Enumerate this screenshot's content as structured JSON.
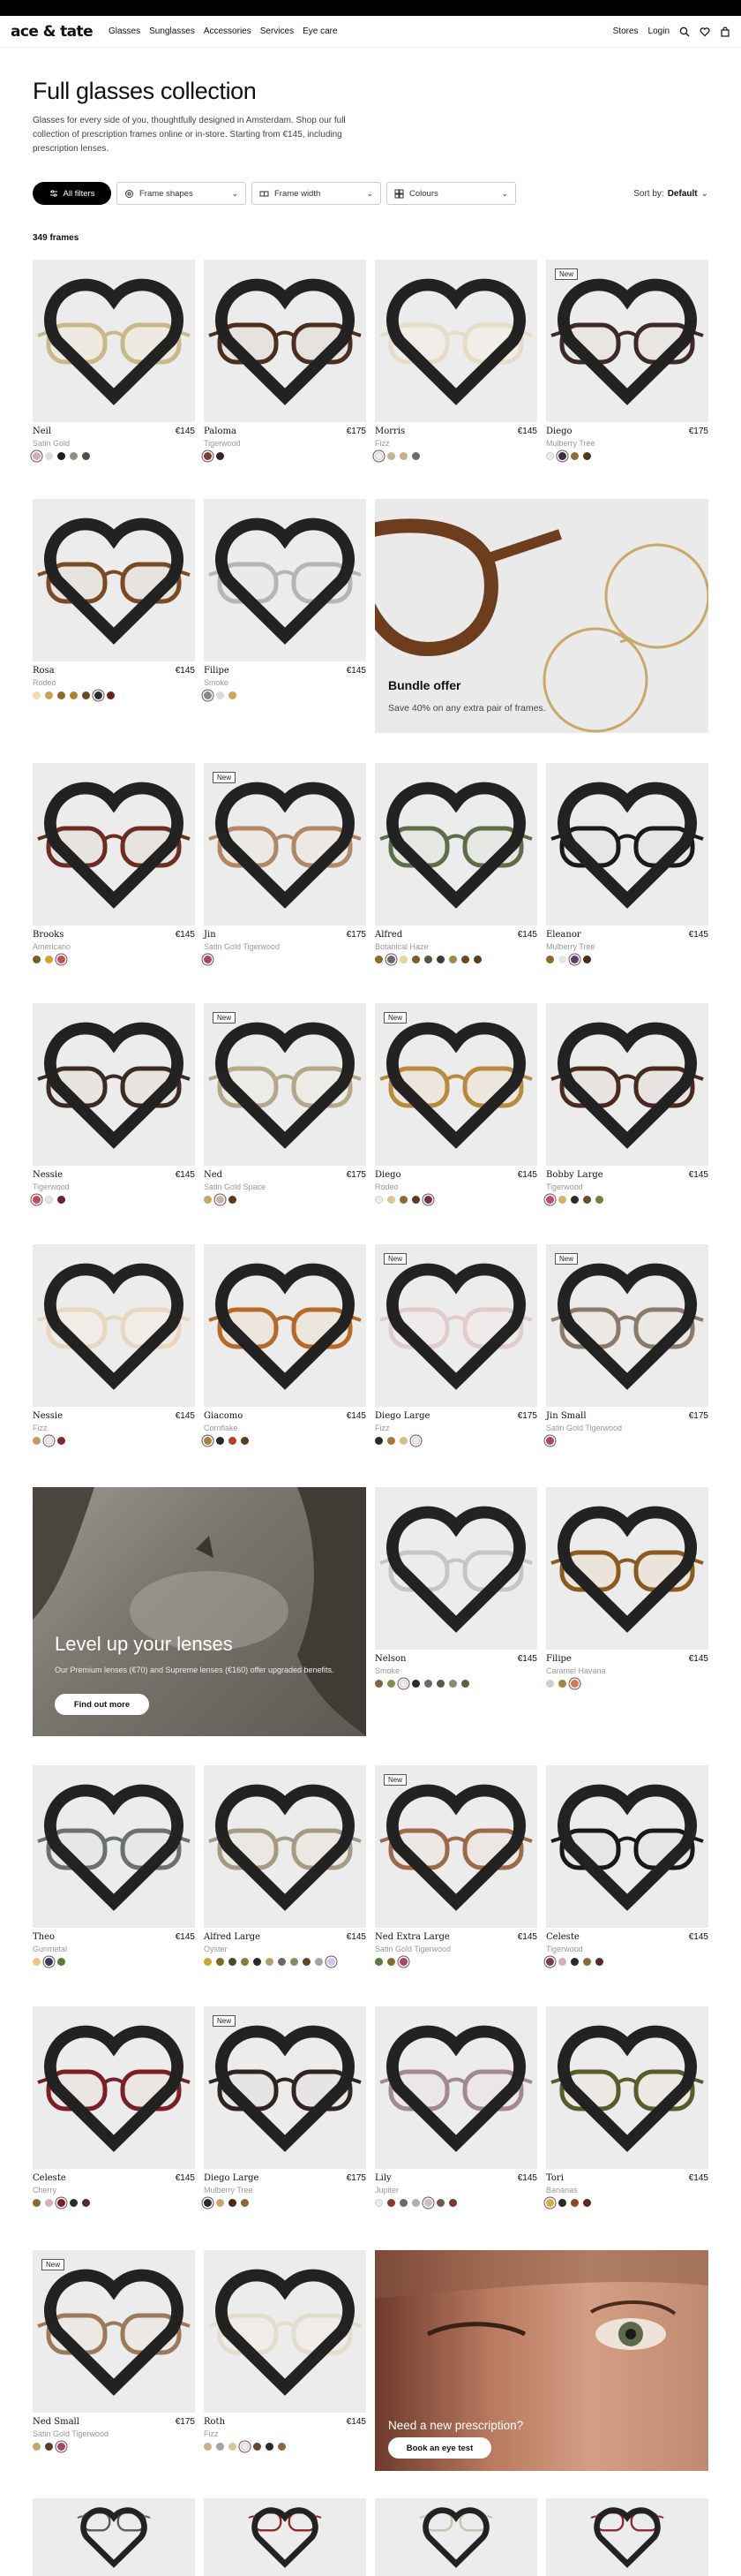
{
  "nav": {
    "logo": "ace & tate",
    "links": [
      "Glasses",
      "Sunglasses",
      "Accessories",
      "Services",
      "Eye care"
    ],
    "stores": "Stores",
    "login": "Login"
  },
  "hero": {
    "title": "Full glasses collection",
    "description": "Glasses for every side of you, thoughtfully designed in Amsterdam. Shop our full collection of prescription frames online or in-store. Starting from €145, including prescription lenses."
  },
  "filters": {
    "all": "All filters",
    "frame_shapes": "Frame shapes",
    "frame_width": "Frame width",
    "colours": "Colours",
    "sort_label": "Sort by:",
    "sort_value": "Default"
  },
  "count": "349 frames",
  "products": [
    {
      "name": "Neil",
      "price": "€145",
      "variant": "Satin Gold",
      "new": false,
      "frame": "#c8b98a",
      "fill": "#eeeae0",
      "swatches": [
        "#d5a9b9",
        "#dcdcdc",
        "#1c1c1c",
        "#8f8f86",
        "#505050"
      ],
      "selected": 0
    },
    {
      "name": "Paloma",
      "price": "€175",
      "variant": "Tigerwood",
      "new": false,
      "frame": "#4a2e1f",
      "fill": "#e6e3df",
      "swatches": [
        "#7b3c34",
        "#3a2220"
      ],
      "selected": 0
    },
    {
      "name": "Morris",
      "price": "€145",
      "variant": "Fizz",
      "new": false,
      "frame": "#e6dcc8",
      "fill": "#f1eee8",
      "swatches": [
        "#eeeaf6",
        "#c7b48b",
        "#c6b08a",
        "#6d6d6d"
      ],
      "selected": 0
    },
    {
      "name": "Diego",
      "price": "€175",
      "variant": "Mulberry Tree",
      "new": true,
      "frame": "#3b2a26",
      "fill": "#e8e5e2",
      "swatches": [
        "#ececec",
        "#3b3042",
        "#8b6f3a",
        "#4b3a1e"
      ],
      "selected": 1
    },
    {
      "name": "Rosa",
      "price": "€145",
      "variant": "Rodeo",
      "new": false,
      "frame": "#7a4a24",
      "fill": "#e7e3dd",
      "swatches": [
        "#f0dba9",
        "#c7a35a",
        "#8c6a2d",
        "#b3812f",
        "#6e4a22",
        "#2b2b2b",
        "#6b1f1f"
      ],
      "selected": 5
    },
    {
      "name": "Filipe",
      "price": "€145",
      "variant": "Smoke",
      "new": false,
      "frame": "#b7b5b2",
      "fill": "#eaeaea",
      "swatches": [
        "#8a8a88",
        "#dadada",
        "#d4a35b"
      ],
      "selected": 0
    },
    {
      "name": "Brooks",
      "price": "€145",
      "variant": "Americano",
      "new": false,
      "frame": "#6b2d22",
      "fill": "#e7e3df",
      "swatches": [
        "#7a5a30",
        "#d1a531",
        "#c44f4f"
      ],
      "selected": 2
    },
    {
      "name": "Jin",
      "price": "€175",
      "variant": "Satin Gold Tigerwood",
      "new": true,
      "frame": "#b08865",
      "fill": "#ece8e3",
      "swatches": [
        "#a8475d"
      ],
      "selected": 0
    },
    {
      "name": "Alfred",
      "price": "€145",
      "variant": "Botanical Haze",
      "new": false,
      "frame": "#5d6d4a",
      "fill": "#e6e7e2",
      "swatches": [
        "#8c6a2d",
        "#6a6a6a",
        "#e7d2a0",
        "#7a5a30",
        "#4d5a3d",
        "#3a3a3a",
        "#a48a4a",
        "#6b4a1e",
        "#5a3d1e"
      ],
      "selected": 1
    },
    {
      "name": "Eleanor",
      "price": "€145",
      "variant": "Mulberry Tree",
      "new": false,
      "frame": "#1a1a1a",
      "fill": "#e6e6e6",
      "swatches": [
        "#8c6a2d",
        "#e5e5e5",
        "#5b3f6d",
        "#4a2a12"
      ],
      "selected": 2
    },
    {
      "name": "Nessie",
      "price": "€145",
      "variant": "Tigerwood",
      "new": false,
      "frame": "#3c2b24",
      "fill": "#e8e5e1",
      "swatches": [
        "#c24a5a",
        "#e6e6e6",
        "#6d1f2a"
      ],
      "selected": 0
    },
    {
      "name": "Ned",
      "price": "€175",
      "variant": "Satin Gold Space",
      "new": true,
      "frame": "#b5a88a",
      "fill": "#ecebe6",
      "swatches": [
        "#c8a66a",
        "#c6b6a4",
        "#5b3a1a"
      ],
      "selected": 1
    },
    {
      "name": "Diego",
      "price": "€145",
      "variant": "Rodeo",
      "new": true,
      "frame": "#b88a3d",
      "fill": "#ece6dc",
      "swatches": [
        "#eeeeee",
        "#d4c79a",
        "#8b6a2d",
        "#5a3d1e",
        "#7a3040"
      ],
      "selected": 4
    },
    {
      "name": "Bobby Large",
      "price": "€145",
      "variant": "Tigerwood",
      "new": false,
      "frame": "#4a2a20",
      "fill": "#e7e4e1",
      "swatches": [
        "#c04a6a",
        "#d4b36a",
        "#2a2a2a",
        "#6b4a2a",
        "#7a7a4a"
      ],
      "selected": 0
    },
    {
      "name": "Nessie",
      "price": "€145",
      "variant": "Fizz",
      "new": false,
      "frame": "#e8d6bf",
      "fill": "#f0ede6",
      "swatches": [
        "#c09a6a",
        "#eeeaf6",
        "#7a2b2b"
      ],
      "selected": 1
    },
    {
      "name": "Giacomo",
      "price": "€145",
      "variant": "Cornflake",
      "new": false,
      "frame": "#b56a2a",
      "fill": "#ece5dc",
      "swatches": [
        "#a4823a",
        "#2a2a2a",
        "#b0402a",
        "#5a3d1e"
      ],
      "selected": 0
    },
    {
      "name": "Diego Large",
      "price": "€175",
      "variant": "Fizz",
      "new": true,
      "frame": "#e0cccc",
      "fill": "#efebea",
      "swatches": [
        "#2a2a2a",
        "#a47a3a",
        "#d2bf8a",
        "#eeeaf6"
      ],
      "selected": 3
    },
    {
      "name": "Jin Small",
      "price": "€175",
      "variant": "Satin Gold Tigerwood",
      "new": true,
      "frame": "#8a7a6a",
      "fill": "#ece9e5",
      "swatches": [
        "#a8475d"
      ],
      "selected": 0
    },
    {
      "name": "Nelson",
      "price": "€145",
      "variant": "Smoke",
      "new": false,
      "frame": "#c4c6c6",
      "fill": "#ebecec",
      "swatches": [
        "#7a6a3a",
        "#8a8a4a",
        "#eeeaf6",
        "#2a2a2a",
        "#6a6a6a",
        "#5a5a4a",
        "#8a8a7a",
        "#4a6a3a"
      ],
      "selected": 2
    },
    {
      "name": "Filipe",
      "price": "€145",
      "variant": "Caramel Havana",
      "new": false,
      "frame": "#8a5a1f",
      "fill": "#ebe4da",
      "swatches": [
        "#d4cfbf",
        "#9a8a4a",
        "#d47a4a"
      ],
      "selected": 2
    },
    {
      "name": "Theo",
      "price": "€145",
      "variant": "Gunmetal",
      "new": false,
      "frame": "#6a706a",
      "fill": "#e7e8e6",
      "swatches": [
        "#e8c68a",
        "#3a3a5a",
        "#5a7a3a"
      ],
      "selected": 1
    },
    {
      "name": "Alfred Large",
      "price": "€145",
      "variant": "Oyster",
      "new": false,
      "frame": "#a59a86",
      "fill": "#ebe8e2",
      "swatches": [
        "#c8a83a",
        "#7a6a2a",
        "#4a4a2a",
        "#8a7a3a",
        "#2a2a2a",
        "#b0a06a",
        "#6a6a6a",
        "#8a8a5a",
        "#5a4a2a",
        "#a4a4a4",
        "#c8c8e0"
      ],
      "selected": 10
    },
    {
      "name": "Ned Extra Large",
      "price": "€145",
      "variant": "Satin Gold Tigerwood",
      "new": true,
      "frame": "#9a6a4a",
      "fill": "#ece7e3",
      "swatches": [
        "#5a7a3a",
        "#8a6a2a",
        "#a8475d"
      ],
      "selected": 2
    },
    {
      "name": "Celeste",
      "price": "€145",
      "variant": "Tigerwood",
      "new": false,
      "frame": "#181818",
      "fill": "#e6e6e6",
      "swatches": [
        "#7a3a5a",
        "#d4b0c0",
        "#2a2a2a",
        "#8a6a3a",
        "#5a2a2a"
      ],
      "selected": 0
    },
    {
      "name": "Celeste",
      "price": "€145",
      "variant": "Cherry",
      "new": false,
      "frame": "#7a1f24",
      "fill": "#ebe5e4",
      "swatches": [
        "#8a6a3a",
        "#d4b0c0",
        "#7a1f24",
        "#2a2a2a",
        "#5a2a2a"
      ],
      "selected": 2
    },
    {
      "name": "Diego Large",
      "price": "€175",
      "variant": "Mulberry Tree",
      "new": true,
      "frame": "#2e2522",
      "fill": "#e7e5e3",
      "swatches": [
        "#2a2a2a",
        "#c8a66a",
        "#4a2a1a",
        "#8a6a3a"
      ],
      "selected": 0
    },
    {
      "name": "Lily",
      "price": "€145",
      "variant": "Jupiter",
      "new": false,
      "frame": "#a08a90",
      "fill": "#ebe7e8",
      "swatches": [
        "#ececec",
        "#8a3a2a",
        "#6a6a6a",
        "#b0b0b0",
        "#c8c0c8",
        "#6a5a4a",
        "#7a3a3a"
      ],
      "selected": 4
    },
    {
      "name": "Tori",
      "price": "€145",
      "variant": "Bananas",
      "new": false,
      "frame": "#5a5a2a",
      "fill": "#ebe9e2",
      "swatches": [
        "#d4b03a",
        "#2a2a2a",
        "#8a4a2a",
        "#5a2a1a"
      ],
      "selected": 0
    },
    {
      "name": "Ned Small",
      "price": "€175",
      "variant": "Satin Gold Tigerwood",
      "new": true,
      "frame": "#9a7a5a",
      "fill": "#ece8e3",
      "swatches": [
        "#c8a66a",
        "#5a3a2a",
        "#a8475d"
      ],
      "selected": 2
    },
    {
      "name": "Roth",
      "price": "€145",
      "variant": "Fizz",
      "new": false,
      "frame": "#e4dccf",
      "fill": "#f0ede8",
      "swatches": [
        "#c8b08a",
        "#a4a4a4",
        "#d4c79a",
        "#eeeaf6",
        "#5a4a3a",
        "#2a2a2a",
        "#8a6a3a"
      ],
      "selected": 3
    }
  ],
  "row_next": [
    {
      "frame": "#5a5a5a"
    },
    {
      "frame": "#8a2a2a"
    },
    {
      "frame": "#c8c0b0"
    },
    {
      "frame": "#8a2a3a"
    }
  ],
  "promos": {
    "bundle_title": "Bundle offer",
    "bundle_sub": "Save 40% on any extra pair of frames.",
    "lenses_title": "Level up your lenses",
    "lenses_sub": "Our Premium lenses (€70) and Supreme lenses (€160) offer upgraded benefits.",
    "lenses_cta": "Find out more",
    "rx_title": "Need a new prescription?",
    "rx_cta": "Book an eye test"
  }
}
